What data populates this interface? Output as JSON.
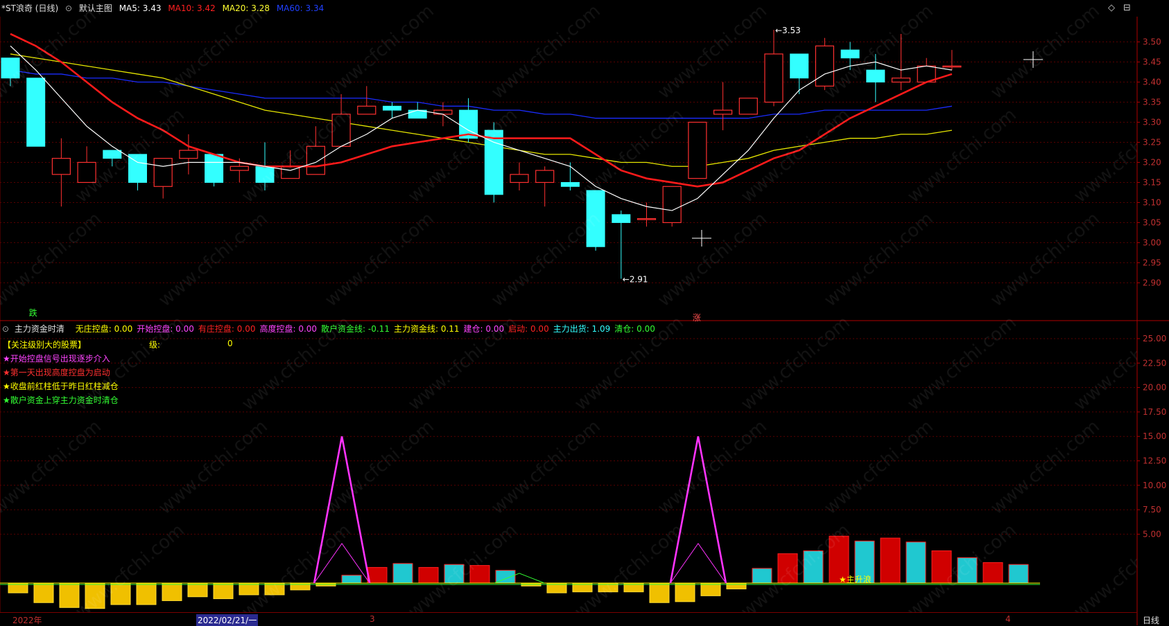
{
  "header": {
    "title": "*ST浪奇 (日线)",
    "template": "默认主图",
    "ma5": "MA5: 3.43",
    "ma10": "MA10: 3.42",
    "ma20": "MA20: 3.28",
    "ma60": "MA60: 3.34"
  },
  "chart_data": {
    "type": "candlestick",
    "price_axis": {
      "min": 2.85,
      "max": 3.55,
      "ticks": [
        "3.50",
        "3.45",
        "3.40",
        "3.35",
        "3.30",
        "3.25",
        "3.20",
        "3.15",
        "3.10",
        "3.05",
        "3.00",
        "2.95",
        "2.90"
      ]
    },
    "candles": [
      {
        "o": 3.46,
        "h": 3.46,
        "l": 3.39,
        "c": 3.41
      },
      {
        "o": 3.41,
        "h": 3.41,
        "l": 3.24,
        "c": 3.24
      },
      {
        "o": 3.17,
        "h": 3.26,
        "l": 3.09,
        "c": 3.21
      },
      {
        "o": 3.15,
        "h": 3.24,
        "l": 3.15,
        "c": 3.2
      },
      {
        "o": 3.23,
        "h": 3.23,
        "l": 3.19,
        "c": 3.21
      },
      {
        "o": 3.22,
        "h": 3.22,
        "l": 3.13,
        "c": 3.15
      },
      {
        "o": 3.14,
        "h": 3.21,
        "l": 3.11,
        "c": 3.21
      },
      {
        "o": 3.21,
        "h": 3.27,
        "l": 3.17,
        "c": 3.23
      },
      {
        "o": 3.22,
        "h": 3.22,
        "l": 3.14,
        "c": 3.15
      },
      {
        "o": 3.18,
        "h": 3.21,
        "l": 3.15,
        "c": 3.19
      },
      {
        "o": 3.19,
        "h": 3.25,
        "l": 3.13,
        "c": 3.15
      },
      {
        "o": 3.16,
        "h": 3.23,
        "l": 3.16,
        "c": 3.19
      },
      {
        "o": 3.17,
        "h": 3.29,
        "l": 3.17,
        "c": 3.24
      },
      {
        "o": 3.24,
        "h": 3.37,
        "l": 3.24,
        "c": 3.32
      },
      {
        "o": 3.32,
        "h": 3.39,
        "l": 3.32,
        "c": 3.34
      },
      {
        "o": 3.34,
        "h": 3.35,
        "l": 3.31,
        "c": 3.33
      },
      {
        "o": 3.33,
        "h": 3.35,
        "l": 3.31,
        "c": 3.31
      },
      {
        "o": 3.32,
        "h": 3.35,
        "l": 3.29,
        "c": 3.33
      },
      {
        "o": 3.33,
        "h": 3.36,
        "l": 3.25,
        "c": 3.26
      },
      {
        "o": 3.28,
        "h": 3.3,
        "l": 3.1,
        "c": 3.12
      },
      {
        "o": 3.15,
        "h": 3.2,
        "l": 3.13,
        "c": 3.17
      },
      {
        "o": 3.15,
        "h": 3.19,
        "l": 3.09,
        "c": 3.18
      },
      {
        "o": 3.15,
        "h": 3.2,
        "l": 3.13,
        "c": 3.14
      },
      {
        "o": 3.13,
        "h": 3.13,
        "l": 2.98,
        "c": 2.99
      },
      {
        "o": 3.07,
        "h": 3.08,
        "l": 2.91,
        "c": 3.05
      },
      {
        "o": 3.06,
        "h": 3.1,
        "l": 3.04,
        "c": 3.06
      },
      {
        "o": 3.05,
        "h": 3.14,
        "l": 3.04,
        "c": 3.14
      },
      {
        "o": 3.16,
        "h": 3.3,
        "l": 3.16,
        "c": 3.3
      },
      {
        "o": 3.32,
        "h": 3.4,
        "l": 3.28,
        "c": 3.33
      },
      {
        "o": 3.32,
        "h": 3.36,
        "l": 3.32,
        "c": 3.36
      },
      {
        "o": 3.35,
        "h": 3.53,
        "l": 3.34,
        "c": 3.47
      },
      {
        "o": 3.47,
        "h": 3.47,
        "l": 3.37,
        "c": 3.41
      },
      {
        "o": 3.39,
        "h": 3.51,
        "l": 3.38,
        "c": 3.49
      },
      {
        "o": 3.48,
        "h": 3.5,
        "l": 3.43,
        "c": 3.46
      },
      {
        "o": 3.43,
        "h": 3.47,
        "l": 3.35,
        "c": 3.4
      },
      {
        "o": 3.4,
        "h": 3.52,
        "l": 3.38,
        "c": 3.41
      },
      {
        "o": 3.4,
        "h": 3.46,
        "l": 3.4,
        "c": 3.44
      },
      {
        "o": 3.44,
        "h": 3.48,
        "l": 3.43,
        "c": 3.44
      }
    ],
    "ma5": [
      3.49,
      3.43,
      3.36,
      3.29,
      3.24,
      3.2,
      3.19,
      3.2,
      3.2,
      3.2,
      3.19,
      3.18,
      3.2,
      3.24,
      3.27,
      3.31,
      3.33,
      3.32,
      3.28,
      3.25,
      3.23,
      3.21,
      3.19,
      3.14,
      3.11,
      3.09,
      3.08,
      3.11,
      3.17,
      3.23,
      3.31,
      3.38,
      3.42,
      3.44,
      3.45,
      3.43,
      3.44,
      3.43
    ],
    "ma10": [
      3.52,
      3.49,
      3.45,
      3.4,
      3.35,
      3.31,
      3.28,
      3.24,
      3.22,
      3.2,
      3.19,
      3.19,
      3.19,
      3.2,
      3.22,
      3.24,
      3.25,
      3.26,
      3.27,
      3.26,
      3.26,
      3.26,
      3.26,
      3.22,
      3.18,
      3.16,
      3.15,
      3.14,
      3.15,
      3.18,
      3.21,
      3.23,
      3.27,
      3.31,
      3.34,
      3.37,
      3.4,
      3.42
    ],
    "ma20": [
      3.47,
      3.46,
      3.45,
      3.44,
      3.43,
      3.42,
      3.41,
      3.39,
      3.37,
      3.35,
      3.33,
      3.32,
      3.31,
      3.3,
      3.29,
      3.28,
      3.27,
      3.26,
      3.25,
      3.24,
      3.23,
      3.22,
      3.22,
      3.21,
      3.2,
      3.2,
      3.19,
      3.19,
      3.2,
      3.21,
      3.23,
      3.24,
      3.25,
      3.26,
      3.26,
      3.27,
      3.27,
      3.28
    ],
    "ma60": [
      3.43,
      3.42,
      3.42,
      3.41,
      3.41,
      3.4,
      3.4,
      3.39,
      3.38,
      3.37,
      3.36,
      3.36,
      3.36,
      3.36,
      3.36,
      3.35,
      3.35,
      3.34,
      3.34,
      3.33,
      3.33,
      3.32,
      3.32,
      3.31,
      3.31,
      3.31,
      3.31,
      3.31,
      3.31,
      3.31,
      3.32,
      3.32,
      3.33,
      3.33,
      3.33,
      3.33,
      3.33,
      3.34
    ],
    "annotations": {
      "high": "3.53",
      "low": "2.91",
      "down_mark": "跌",
      "up_mark": "涨"
    }
  },
  "indicator": {
    "name": "主力资金时清",
    "values": [
      {
        "label": "无庄控盘: 0.00",
        "color": "#ffff00"
      },
      {
        "label": "开始控盘: 0.00",
        "color": "#ff44ff"
      },
      {
        "label": "有庄控盘: 0.00",
        "color": "#ff2222"
      },
      {
        "label": "高度控盘: 0.00",
        "color": "#ff44ff"
      },
      {
        "label": "散户资金线: -0.11",
        "color": "#33ff33"
      },
      {
        "label": "主力资金线: 0.11",
        "color": "#ffff00"
      },
      {
        "label": "建仓: 0.00",
        "color": "#ff44ff"
      },
      {
        "label": "启动: 0.00",
        "color": "#ff2222"
      },
      {
        "label": "主力出货: 1.09",
        "color": "#33ffff"
      },
      {
        "label": "清仓: 0.00",
        "color": "#33ff33"
      }
    ],
    "notes": [
      {
        "text": "【关注级别大的股票】",
        "color": "#ffff00"
      },
      {
        "text": "★开始控盘信号出现逐步介入",
        "color": "#ff44ff"
      },
      {
        "text": "★第一天出现高度控盘为启动",
        "color": "#ff2222"
      },
      {
        "text": "★收盘前红柱低于昨日红柱减仓",
        "color": "#ffff00"
      },
      {
        "text": "★散户资金上穿主力资金时清仓",
        "color": "#33ff33"
      }
    ],
    "level_label": "级:",
    "level_value": "0",
    "star_label": "★主升浪",
    "axis_ticks": [
      "25.00",
      "22.50",
      "20.00",
      "17.50",
      "15.00",
      "12.50",
      "10.00",
      "7.50",
      "5.00"
    ],
    "axis_range": [
      0,
      26.5
    ],
    "bars": [
      -1.0,
      -2.0,
      -2.5,
      -2.6,
      -2.2,
      -2.2,
      -1.8,
      -1.4,
      -1.6,
      -1.2,
      -1.2,
      -0.7,
      -0.3,
      0.8,
      1.6,
      2.0,
      1.6,
      1.9,
      1.8,
      1.3,
      -0.3,
      -1.0,
      -0.9,
      -0.9,
      -0.9,
      -2.0,
      -1.9,
      -1.3,
      -0.6,
      1.5,
      3.0,
      3.3,
      4.8,
      4.3,
      4.6,
      4.2,
      3.3,
      2.6,
      2.1,
      1.9
    ],
    "magenta_spikes": [
      {
        "index": 13,
        "value": 15.0
      },
      {
        "index": 27,
        "value": 15.0
      }
    ],
    "green_spike": {
      "index": 20,
      "value": 1.0
    }
  },
  "dates": {
    "d1": "2022年",
    "d2": "2022/02/21/一",
    "d3": "3",
    "d4": "4"
  },
  "footer": {
    "period": "日线"
  },
  "watermark": "www.cfchi.com"
}
